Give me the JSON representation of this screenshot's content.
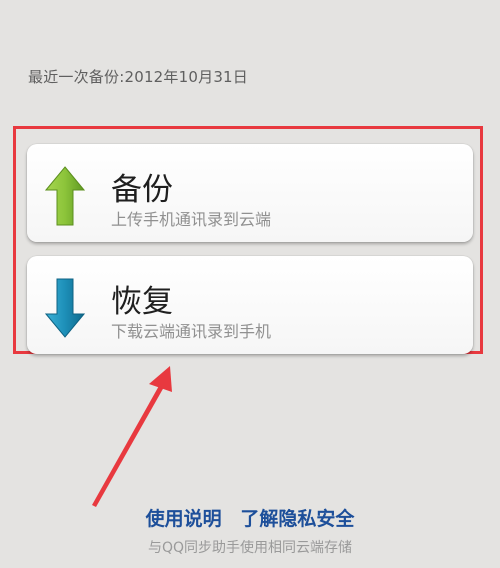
{
  "status": {
    "last_backup": "最近一次备份:2012年10月31日"
  },
  "actions": [
    {
      "title": "备份",
      "description": "上传手机通讯录到云端",
      "icon": "up-arrow-icon",
      "color": "#8cc43a"
    },
    {
      "title": "恢复",
      "description": "下载云端通讯录到手机",
      "icon": "down-arrow-icon",
      "color": "#1d8fb8"
    }
  ],
  "footer": {
    "link_usage": "使用说明",
    "link_privacy": "了解隐私安全",
    "note": "与QQ同步助手使用相同云端存储"
  },
  "colors": {
    "annotation_red": "#e8393f",
    "link_blue": "#1d4f9a"
  }
}
